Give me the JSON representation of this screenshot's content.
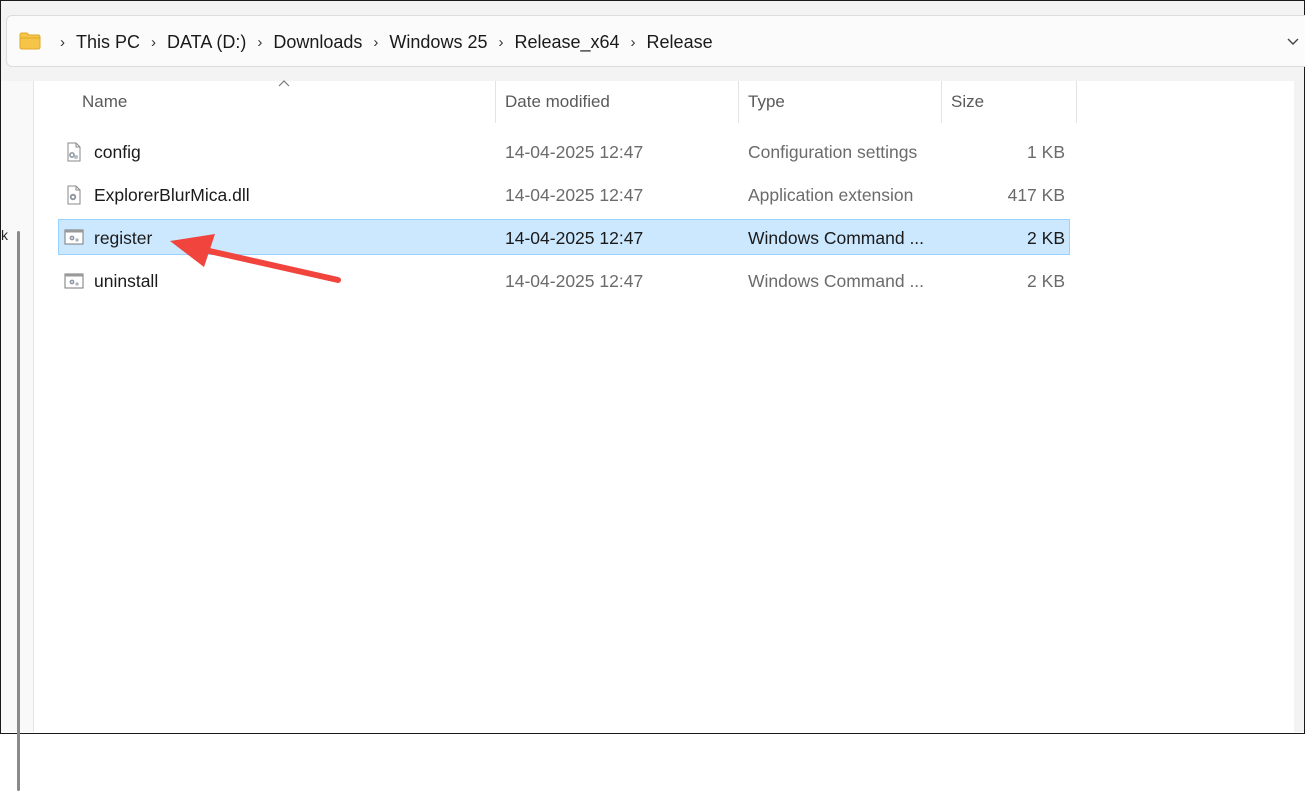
{
  "breadcrumb": [
    "This PC",
    "DATA (D:)",
    "Downloads",
    "Windows 25",
    "Release_x64",
    "Release"
  ],
  "columns": {
    "name": "Name",
    "date_modified": "Date modified",
    "type": "Type",
    "size": "Size"
  },
  "files": [
    {
      "name": "config",
      "date": "14-04-2025 12:47",
      "type": "Configuration settings",
      "size": "1 KB",
      "icon": "config-file-icon"
    },
    {
      "name": "ExplorerBlurMica.dll",
      "date": "14-04-2025 12:47",
      "type": "Application extension",
      "size": "417 KB",
      "icon": "dll-file-icon"
    },
    {
      "name": "register",
      "date": "14-04-2025 12:47",
      "type": "Windows Command ...",
      "size": "2 KB",
      "icon": "cmd-file-icon",
      "selected": true
    },
    {
      "name": "uninstall",
      "date": "14-04-2025 12:47",
      "type": "Windows Command ...",
      "size": "2 KB",
      "icon": "cmd-file-icon"
    }
  ],
  "left_pane_glyph": "k",
  "colors": {
    "selection_bg": "#cce8ff",
    "selection_border": "#99d1ff",
    "annotation_arrow": "#f0443c",
    "folder": "#f6c548"
  }
}
